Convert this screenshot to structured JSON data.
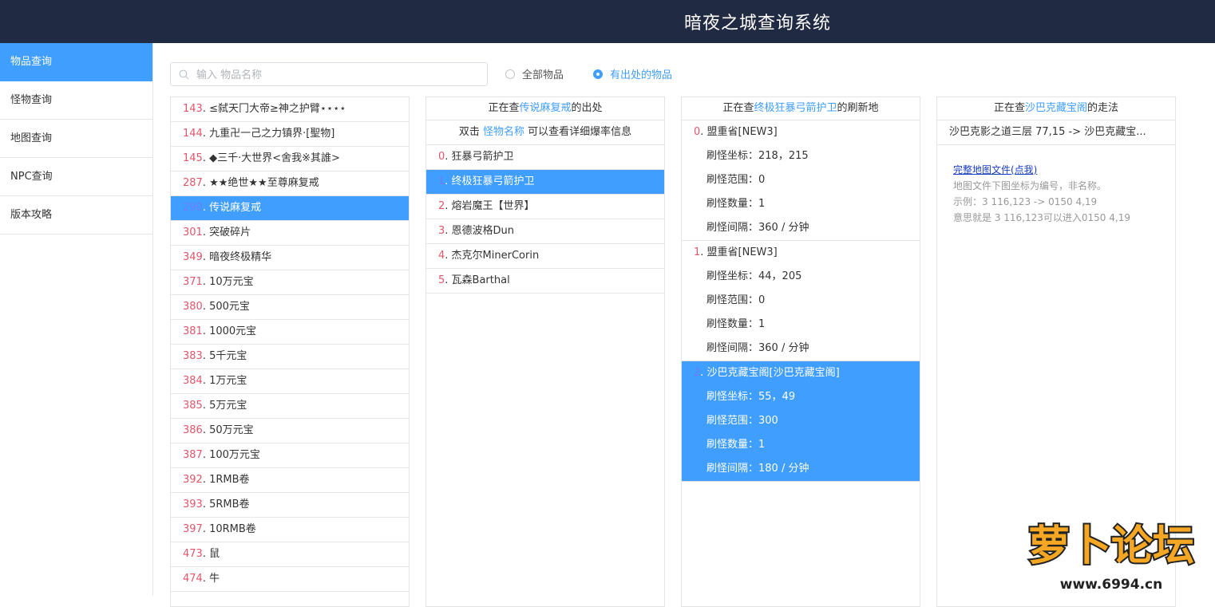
{
  "header": {
    "title": "暗夜之城查询系统"
  },
  "sidebar": {
    "items": [
      {
        "label": "物品查询",
        "active": true
      },
      {
        "label": "怪物查询",
        "active": false
      },
      {
        "label": "地图查询",
        "active": false
      },
      {
        "label": "NPC查询",
        "active": false
      },
      {
        "label": "版本攻略",
        "active": false
      }
    ]
  },
  "search": {
    "placeholder": "输入 物品名称",
    "value": ""
  },
  "filters": {
    "all_label": "全部物品",
    "with_source_label": "有出处的物品",
    "selected": "with_source"
  },
  "items": [
    {
      "id": "143",
      "name": "≤弑天冂大帝≥神之护臂⋆⋆⋆⋆"
    },
    {
      "id": "144",
      "name": "九重卍一己之力镇界·[聖物]"
    },
    {
      "id": "145",
      "name": "◆三千·大世界<舍我※其誰>"
    },
    {
      "id": "287",
      "name": "★★绝世★★至尊麻复戒"
    },
    {
      "id": "290",
      "name": "传说麻复戒",
      "selected": true
    },
    {
      "id": "301",
      "name": "突破碎片"
    },
    {
      "id": "349",
      "name": "暗夜终极精华"
    },
    {
      "id": "371",
      "name": "10万元宝"
    },
    {
      "id": "380",
      "name": "500元宝"
    },
    {
      "id": "381",
      "name": "1000元宝"
    },
    {
      "id": "383",
      "name": "5千元宝"
    },
    {
      "id": "384",
      "name": "1万元宝"
    },
    {
      "id": "385",
      "name": "5万元宝"
    },
    {
      "id": "386",
      "name": "50万元宝"
    },
    {
      "id": "387",
      "name": "100万元宝"
    },
    {
      "id": "392",
      "name": "1RMB卷"
    },
    {
      "id": "393",
      "name": "5RMB卷"
    },
    {
      "id": "397",
      "name": "10RMB卷"
    },
    {
      "id": "473",
      "name": "鼠"
    },
    {
      "id": "474",
      "name": "牛"
    }
  ],
  "source_panel": {
    "prefix": "正在查",
    "item": "传说麻复戒",
    "suffix": "的出处",
    "hint_a": "双击",
    "hint_b": "怪物名称",
    "hint_c": "可以查看详细爆率信息",
    "monsters": [
      {
        "id": "0",
        "name": "狂暴弓箭护卫"
      },
      {
        "id": "1",
        "name": "终极狂暴弓箭护卫",
        "selected": true
      },
      {
        "id": "2",
        "name": "熔岩魔王【世界】"
      },
      {
        "id": "3",
        "name": "恩德波格Dun"
      },
      {
        "id": "4",
        "name": "杰克尔MinerCorin"
      },
      {
        "id": "5",
        "name": "瓦森Barthal"
      }
    ]
  },
  "spawn_panel": {
    "prefix": "正在查",
    "monster": "终极狂暴弓箭护卫",
    "suffix": "的刷新地",
    "groups": [
      {
        "id": "0",
        "map": "盟重省[NEW3]",
        "coord": "刷怪坐标：218，215",
        "range": "刷怪范围：0",
        "count": "刷怪数量：1",
        "interval": "刷怪间隔：360 / 分钟"
      },
      {
        "id": "1",
        "map": "盟重省[NEW3]",
        "coord": "刷怪坐标：44，205",
        "range": "刷怪范围：0",
        "count": "刷怪数量：1",
        "interval": "刷怪间隔：360 / 分钟"
      },
      {
        "id": "2",
        "map": "沙巴克藏宝阁[沙巴克藏宝阁]",
        "coord": "刷怪坐标：55，49",
        "range": "刷怪范围：300",
        "count": "刷怪数量：1",
        "interval": "刷怪间隔：180 / 分钟",
        "selected": true
      }
    ]
  },
  "route_panel": {
    "prefix": "正在查",
    "map": "沙巴克藏宝阁",
    "suffix": "的走法",
    "route": "沙巴克影之道三层 77,15 -> 沙巴克藏宝...",
    "link": "完整地图文件(点我)",
    "note1": "地图文件下图坐标为编号，非名称。",
    "note2": "示例：3 116,123 -> 0150 4,19",
    "note3": "意思就是 3 116,123可以进入0150 4,19"
  },
  "watermark": {
    "brand": "萝卜论坛",
    "url": "www.6994.cn"
  },
  "colors": {
    "header_bg": "#212a43",
    "accent": "#409eff",
    "index_red": "#e0566b"
  }
}
